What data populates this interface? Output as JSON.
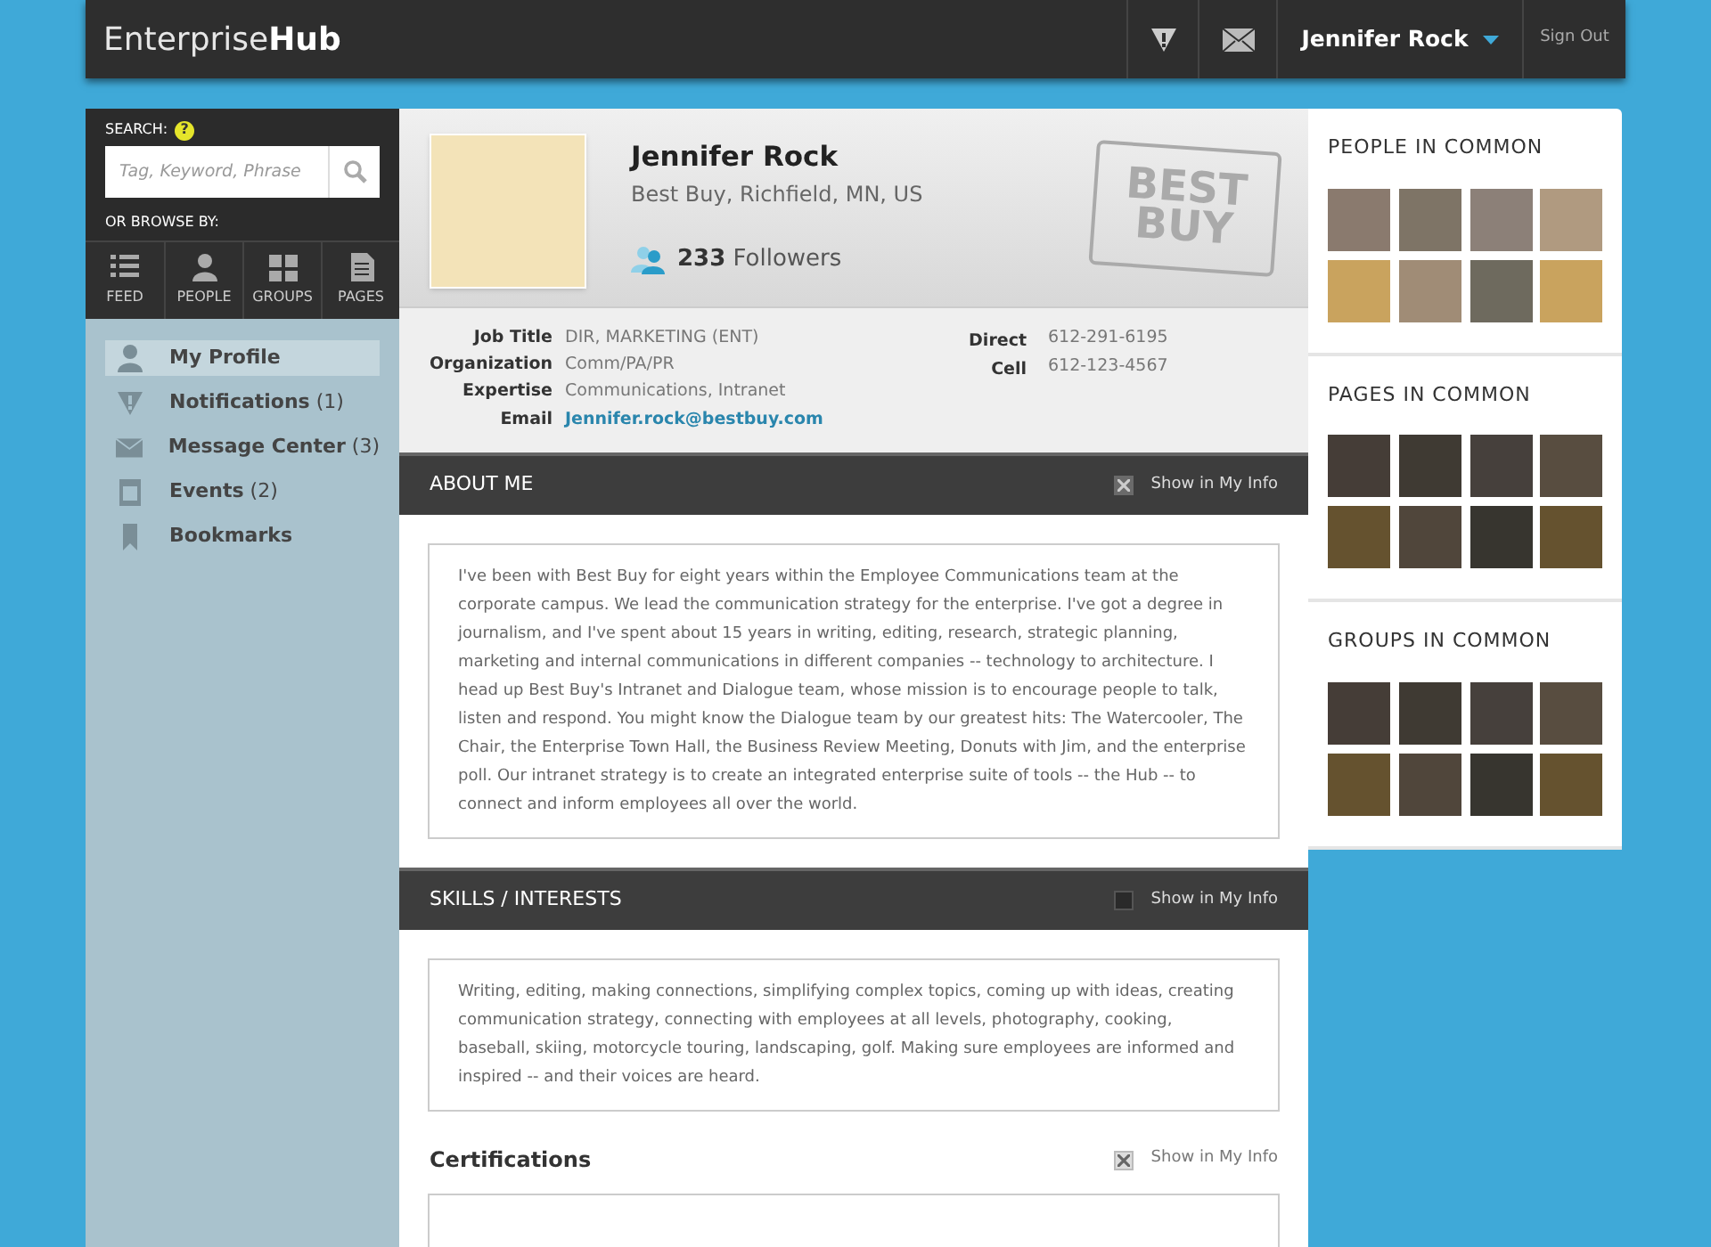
{
  "header": {
    "logo_light": "Enterprise",
    "logo_bold": "Hub",
    "user_name": "Jennifer Rock",
    "sign_out": "Sign Out"
  },
  "sidebar": {
    "search_label": "SEARCH:",
    "help": "?",
    "search_placeholder": "Tag, Keyword, Phrase",
    "browse_label": "OR BROWSE BY:",
    "browse": [
      {
        "kind": "feed",
        "label": "FEED"
      },
      {
        "kind": "people",
        "label": "PEOPLE"
      },
      {
        "kind": "groups",
        "label": "GROUPS"
      },
      {
        "kind": "pages",
        "label": "PAGES"
      }
    ],
    "nav": [
      {
        "kind": "profile",
        "label": "My Profile",
        "selected": true
      },
      {
        "kind": "notifications",
        "label": "Notifications",
        "count": "(1)",
        "selected": false
      },
      {
        "kind": "messages",
        "label": "Message Center",
        "count": "(3)",
        "selected": false
      },
      {
        "kind": "events",
        "label": "Events",
        "count": "(2)",
        "selected": false
      },
      {
        "kind": "bookmarks",
        "label": "Bookmarks",
        "selected": false
      }
    ]
  },
  "profile": {
    "name": "Jennifer Rock",
    "location": "Best Buy, Richfield, MN, US",
    "followers_count": "233",
    "followers_label": "Followers",
    "logo_line_1": "BEST",
    "logo_line_2": "BUY",
    "details": [
      {
        "label": "Job Title",
        "value": "DIR, MARKETING (ENT)",
        "kind": "text"
      },
      {
        "label": "Organization",
        "value": "Comm/PA/PR",
        "kind": "text"
      },
      {
        "label": "Expertise",
        "value": "Communications, Intranet",
        "kind": "text"
      },
      {
        "label": "Email",
        "value": "Jennifer.rock@bestbuy.com",
        "kind": "link"
      }
    ],
    "phones": [
      {
        "label": "Direct",
        "value": "612-291-6195"
      },
      {
        "label": "Cell",
        "value": "612-123-4567"
      }
    ]
  },
  "sections": [
    {
      "title": "ABOUT ME",
      "show_label": "Show in My Info",
      "checked": true,
      "text": "I've been with Best Buy for eight years within the Employee Communications team at the corporate campus. We lead the communication strategy for the enterprise. I've got a degree in journalism, and I've spent about 15 years in writing, editing, research, strategic planning, marketing and internal communications in different companies -- technology to architecture. I head up Best Buy's Intranet and Dialogue team, whose mission is to encourage people to talk, listen and respond. You might know the Dialogue team by our greatest hits: The Watercooler, The Chair, the Enterprise Town Hall, the Business Review Meeting, Donuts with Jim, and the enterprise poll. Our intranet strategy is to create an integrated enterprise suite of tools -- the Hub -- to connect and inform employees all over the world."
    },
    {
      "title": "SKILLS / INTERESTS",
      "show_label": "Show in My Info",
      "checked": false,
      "text": "Writing, editing, making connections, simplifying complex topics, coming up with ideas, creating communication strategy, connecting with employees at all levels,  photography, cooking, baseball, skiing, motorcycle touring, landscaping, golf. Making sure employees are informed and inspired -- and their voices are heard."
    }
  ],
  "certifications": {
    "title": "Certifications",
    "show_label": "Show in My Info",
    "checked": true
  },
  "common": [
    {
      "title": "PEOPLE IN COMMON",
      "dimmed": false
    },
    {
      "title": "PAGES IN COMMON",
      "dimmed": true
    },
    {
      "title": "GROUPS IN COMMON",
      "dimmed": true
    }
  ]
}
